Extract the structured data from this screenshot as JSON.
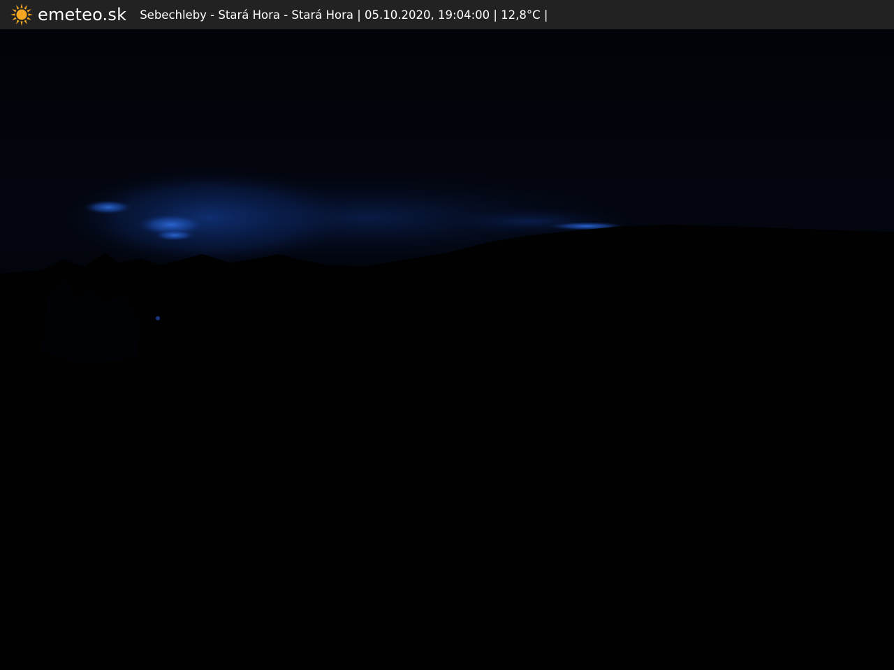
{
  "header": {
    "brand": "emeteo.sk",
    "logo_icon": "sun-icon",
    "logo_color": "#f5a623",
    "caption": "Sebechleby - Stará Hora - Stará Hora | 05.10.2020, 19:04:00 | 12,8°C |"
  },
  "scene": {
    "description_kind": "webcam-night-image",
    "sky_glow_color": "#1d4fb0",
    "ground_color": "#010101"
  }
}
